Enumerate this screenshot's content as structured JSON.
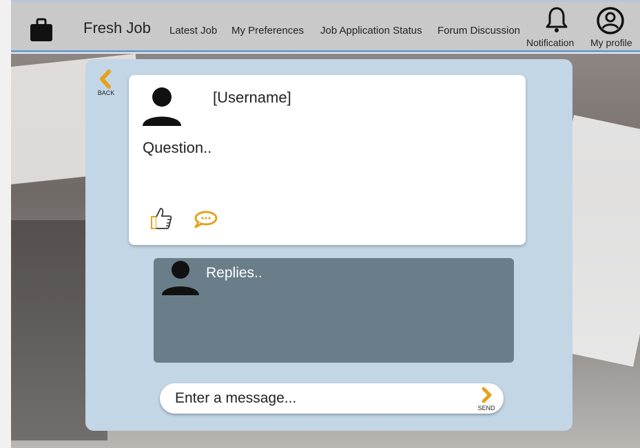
{
  "app": {
    "name": "Fresh Job"
  },
  "nav": {
    "latest_job": "Latest Job",
    "my_preferences": "My Preferences",
    "job_application_status": "Job Application Status",
    "forum_discussion": "Forum Discussion",
    "notification": "Notification",
    "my_profile": "My profile"
  },
  "post": {
    "back_label": "BACK",
    "username": "[Username]",
    "question": "Question..",
    "like_icon": "thumbs-up-icon",
    "comment_icon": "speech-bubble-icon"
  },
  "reply": {
    "text": "Replies.."
  },
  "message": {
    "placeholder": "Enter a message...",
    "send_label": "SEND"
  },
  "colors": {
    "accent": "#e6a21a",
    "panel": "#c3d6e6",
    "reply_box": "#6a7e8a",
    "topbar": "#c9c9c9"
  }
}
